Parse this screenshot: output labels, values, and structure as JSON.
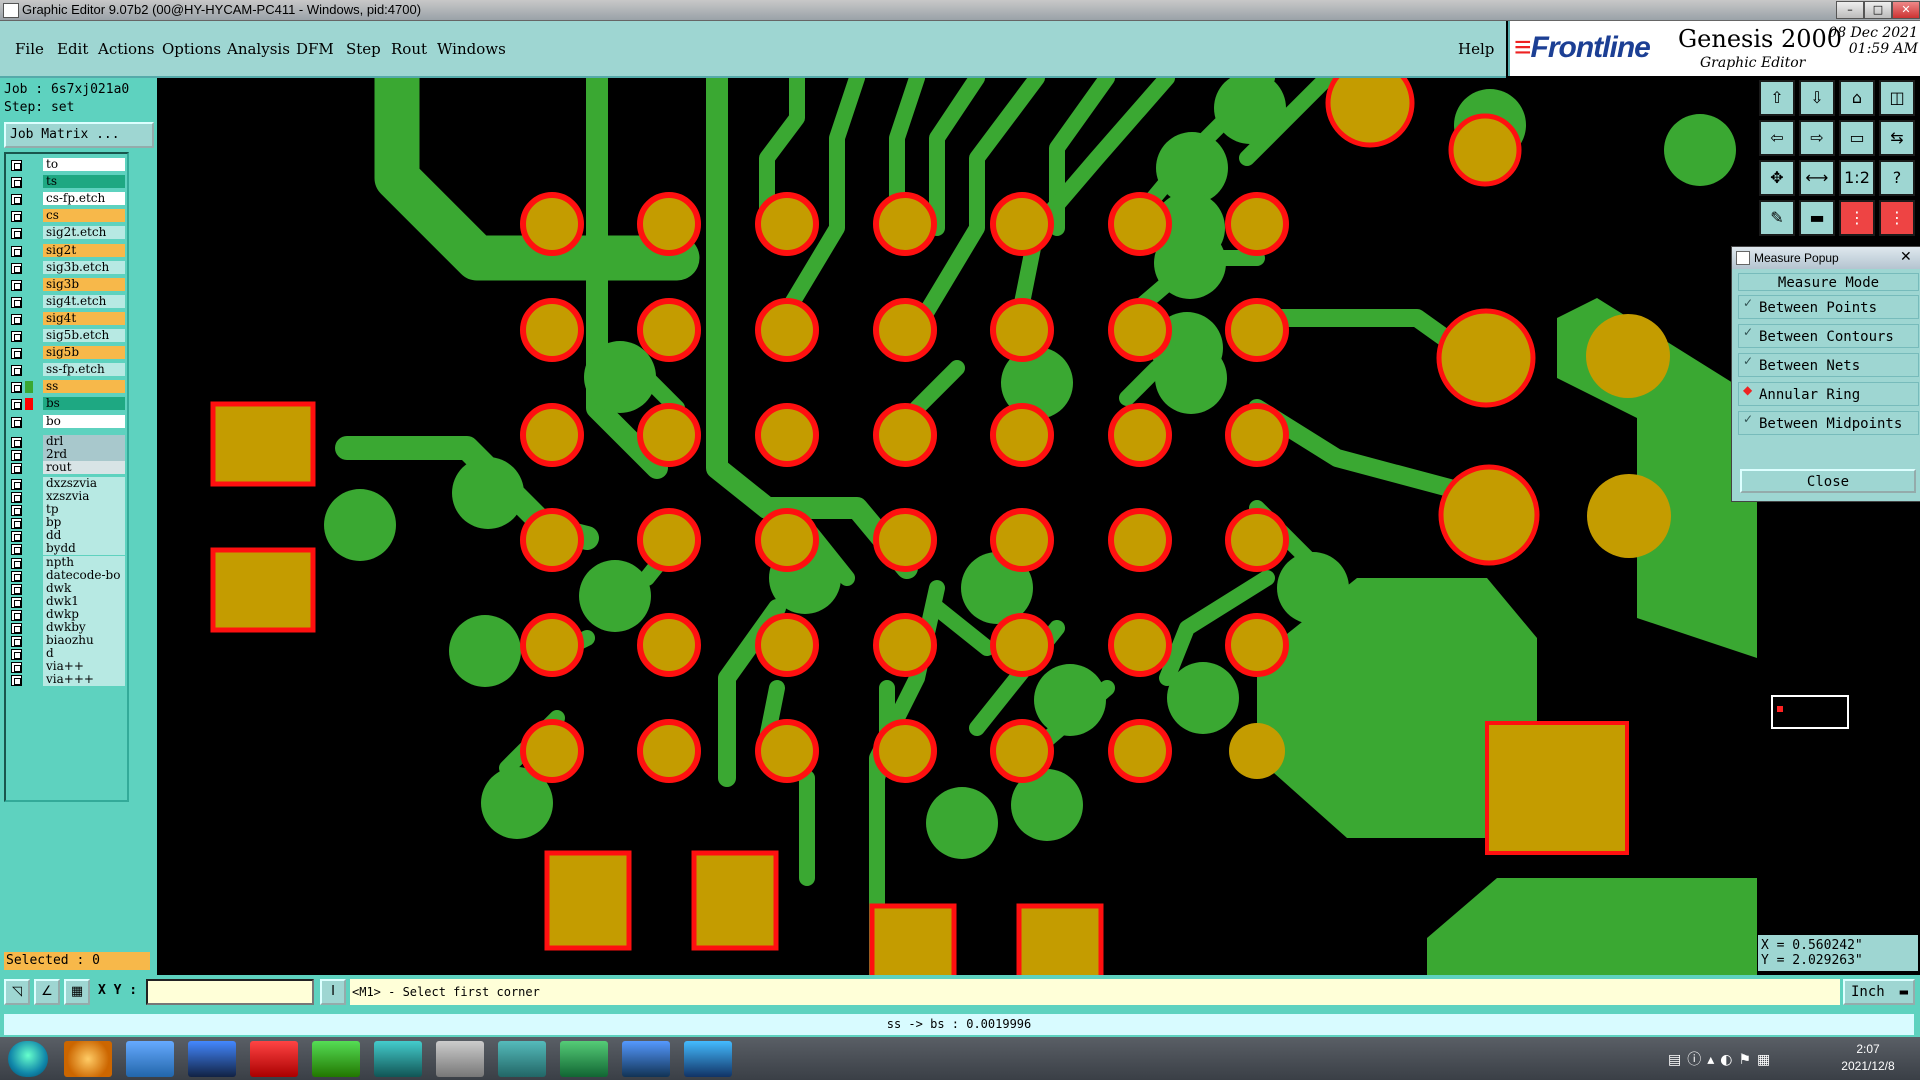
{
  "window": {
    "title": "Graphic Editor 9.07b2 (00@HY-HYCAM-PC411 - Windows, pid:4700)",
    "controls": [
      "–",
      "□",
      "✕"
    ]
  },
  "menu": [
    "File",
    "Edit",
    "Actions",
    "Options",
    "Analysis",
    "DFM",
    "Step",
    "Rout",
    "Windows"
  ],
  "help_label": "Help",
  "brand": {
    "logo": "Frontline",
    "product": "Genesis 2000",
    "subtitle": "Graphic Editor",
    "date": "08 Dec 2021",
    "time": "01:59 AM"
  },
  "job": {
    "job_line": "Job : 6s7xj021a0",
    "step_line": "Step: set",
    "job_matrix_label": "Job Matrix ..."
  },
  "layers": [
    {
      "name": "to",
      "color": "#ffffff",
      "swatch": ""
    },
    {
      "name": "ts",
      "color": "#1ea882",
      "swatch": ""
    },
    {
      "name": "cs-fp.etch",
      "color": "#ffffff",
      "swatch": ""
    },
    {
      "name": "cs",
      "color": "#f7b84a",
      "swatch": ""
    },
    {
      "name": "sig2t.etch",
      "color": "#b7e9e3",
      "swatch": ""
    },
    {
      "name": "sig2t",
      "color": "#f7b84a",
      "swatch": ""
    },
    {
      "name": "sig3b.etch",
      "color": "#b7e9e3",
      "swatch": ""
    },
    {
      "name": "sig3b",
      "color": "#f7b84a",
      "swatch": ""
    },
    {
      "name": "sig4t.etch",
      "color": "#b7e9e3",
      "swatch": ""
    },
    {
      "name": "sig4t",
      "color": "#f7b84a",
      "swatch": ""
    },
    {
      "name": "sig5b.etch",
      "color": "#b7e9e3",
      "swatch": ""
    },
    {
      "name": "sig5b",
      "color": "#f7b84a",
      "swatch": ""
    },
    {
      "name": "ss-fp.etch",
      "color": "#b7e9e3",
      "swatch": ""
    },
    {
      "name": "ss",
      "color": "#f7b84a",
      "swatch": "#3aa832"
    },
    {
      "name": "bs",
      "color": "#1ea882",
      "swatch": "#ff0000"
    },
    {
      "name": "bo",
      "color": "#ffffff",
      "swatch": ""
    },
    {
      "name": "drl",
      "color": "#a8c8cc",
      "swatch": ""
    },
    {
      "name": "2rd",
      "color": "#a8c8cc",
      "swatch": ""
    },
    {
      "name": "rout",
      "color": "#d8e4e6",
      "swatch": ""
    },
    {
      "name": "dxzszvia",
      "color": "#b7e9e3",
      "swatch": ""
    },
    {
      "name": "xzszvia",
      "color": "#b7e9e3",
      "swatch": ""
    },
    {
      "name": "tp",
      "color": "#b7e9e3",
      "swatch": ""
    },
    {
      "name": "bp",
      "color": "#b7e9e3",
      "swatch": ""
    },
    {
      "name": "dd",
      "color": "#b7e9e3",
      "swatch": ""
    },
    {
      "name": "bydd",
      "color": "#b7e9e3",
      "swatch": ""
    },
    {
      "name": "npth",
      "color": "#b7e9e3",
      "swatch": ""
    },
    {
      "name": "datecode-bo",
      "color": "#b7e9e3",
      "swatch": ""
    },
    {
      "name": "dwk",
      "color": "#b7e9e3",
      "swatch": ""
    },
    {
      "name": "dwk1",
      "color": "#b7e9e3",
      "swatch": ""
    },
    {
      "name": "dwkp",
      "color": "#b7e9e3",
      "swatch": ""
    },
    {
      "name": "dwkby",
      "color": "#b7e9e3",
      "swatch": ""
    },
    {
      "name": "biaozhu",
      "color": "#b7e9e3",
      "swatch": ""
    },
    {
      "name": "d",
      "color": "#b7e9e3",
      "swatch": ""
    },
    {
      "name": "via++",
      "color": "#b7e9e3",
      "swatch": ""
    },
    {
      "name": "via+++",
      "color": "#b7e9e3",
      "swatch": ""
    }
  ],
  "selected_label": "Selected : 0",
  "toolbar_icons": [
    "zoom-home-icon",
    "zoom-in-icon",
    "home-icon",
    "panel-icon",
    "pan-left-icon",
    "pan-right-icon",
    "snap-icon",
    "mirror-icon",
    "fit-icon",
    "move-icon",
    "scale-icon",
    "help-icon",
    "pin-icon",
    "measure-icon",
    "grid-icon",
    "layers-icon"
  ],
  "toolbar_glyphs": [
    "⇧",
    "⇩",
    "⌂",
    "◫",
    "⇦",
    "⇨",
    "▭",
    "⇆",
    "✥",
    "⟷",
    "1:2",
    "?",
    "✎",
    "▬",
    "⋮",
    "⋮"
  ],
  "measure_popup": {
    "title": "Measure Popup",
    "header": "Measure Mode",
    "items": [
      {
        "label": "Between Points",
        "mark": "✓"
      },
      {
        "label": "Between Contours",
        "mark": "✓"
      },
      {
        "label": "Between Nets",
        "mark": "✓"
      },
      {
        "label": "Annular Ring",
        "mark": "◆"
      },
      {
        "label": "Between Midpoints",
        "mark": "✓"
      }
    ],
    "close_label": "Close"
  },
  "cursor": {
    "x_line": "X = 0.560242\"",
    "y_line": "Y = 2.029263\""
  },
  "statusbar": {
    "xy_label": "X Y :",
    "xy_value": "",
    "prompt": "<M1> - Select first corner",
    "unit": "Inch"
  },
  "info_line": "ss -> bs : 0.0019996",
  "taskbar": {
    "time": "2:07",
    "date": "2021/12/8"
  },
  "colors": {
    "copper": "#3aa832",
    "pad": "#c49c00",
    "mask": "#ff1010",
    "panel": "#5ed2bf",
    "menubar": "#9ed6d2"
  }
}
